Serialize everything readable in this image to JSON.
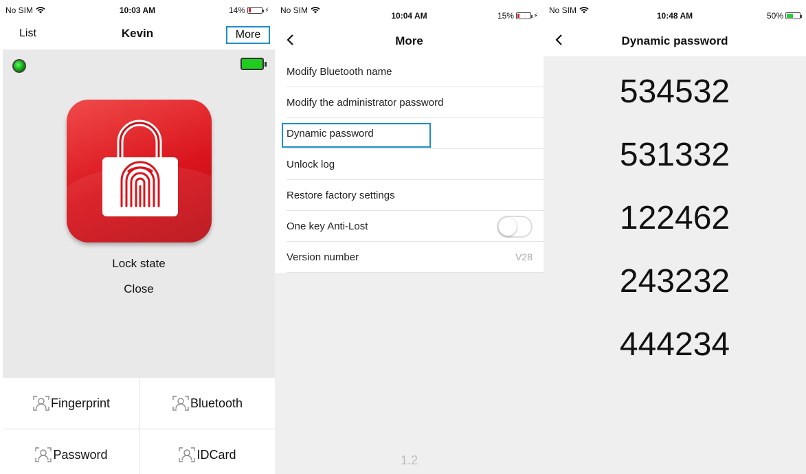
{
  "screen1": {
    "status": {
      "carrier": "No SIM",
      "time": "10:03 AM",
      "battery": "14%",
      "battery_level": 0.14
    },
    "nav": {
      "left": "List",
      "title": "Kevin",
      "right": "More"
    },
    "lock_state_label": "Lock state",
    "lock_state_value": "Close",
    "buttons": [
      {
        "label": "Fingerprint",
        "icon": "user-scan-icon"
      },
      {
        "label": "Bluetooth",
        "icon": "user-scan-icon"
      },
      {
        "label": "Password",
        "icon": "user-scan-icon"
      },
      {
        "label": "IDCard",
        "icon": "user-scan-icon"
      }
    ],
    "colors": {
      "lock_tile": "#d9141c",
      "highlight": "#1d8ecb",
      "led": "#0a9c0a",
      "battery": "#1fcc1f"
    }
  },
  "screen2": {
    "status": {
      "carrier": "No SIM",
      "time": "10:04 AM",
      "battery": "15%",
      "battery_level": 0.15
    },
    "nav": {
      "title": "More"
    },
    "menu": [
      {
        "label": "Modify Bluetooth name"
      },
      {
        "label": "Modify the administrator password"
      },
      {
        "label": "Dynamic password",
        "highlighted": true
      },
      {
        "label": "Unlock log"
      },
      {
        "label": "Restore factory settings"
      },
      {
        "label": "One key Anti-Lost",
        "toggle": false
      },
      {
        "label": "Version number",
        "value": "V28"
      }
    ],
    "footer_version": "1.2"
  },
  "screen3": {
    "status": {
      "carrier": "No SIM",
      "time": "10:48 AM",
      "battery": "50%",
      "battery_level": 0.5
    },
    "nav": {
      "title": "Dynamic password"
    },
    "codes": [
      "534532",
      "531332",
      "122462",
      "243232",
      "444234"
    ]
  }
}
